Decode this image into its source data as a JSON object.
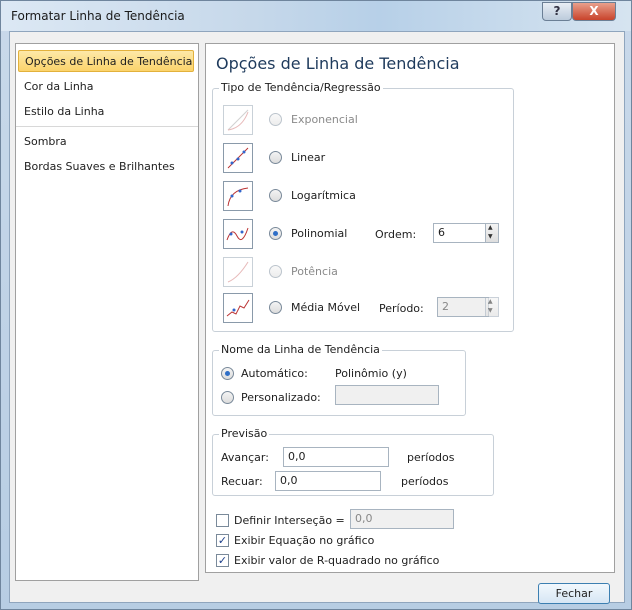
{
  "window": {
    "title": "Formatar Linha de Tendência",
    "help": "?",
    "close": "X"
  },
  "nav": {
    "items": [
      "Opções de Linha de Tendência",
      "Cor da Linha",
      "Estilo da Linha",
      "Sombra",
      "Bordas Suaves e Brilhantes"
    ],
    "selected": 0
  },
  "panel": {
    "title": "Opções de Linha de Tendência",
    "type_group": "Tipo de Tendência/Regressão",
    "types": {
      "exponencial": "Exponencial",
      "linear": "Linear",
      "logaritmica": "Logarítmica",
      "polinomial": "Polinomial",
      "potencia": "Potência",
      "media_movel": "Média Móvel"
    },
    "selected_type": "Polinomial",
    "ordem_label": "Ordem:",
    "ordem_value": "6",
    "periodo_label": "Período:",
    "periodo_value": "2",
    "name_group": "Nome da Linha de Tendência",
    "automatico_label": "Automático:",
    "automatico_value": "Polinômio (y)",
    "personalizado_label": "Personalizado:",
    "personalizado_value": "",
    "previsao_group": "Previsão",
    "avancar_label": "Avançar:",
    "avancar_value": "0,0",
    "recuar_label": "Recuar:",
    "recuar_value": "0,0",
    "periodos_1": "períodos",
    "periodos_2": "períodos",
    "interseccao_label": "Definir Interseção =",
    "interseccao_value": "0,0",
    "interseccao_checked": false,
    "equacao_label": "Exibir Equação no gráfico",
    "equacao_checked": true,
    "r2_label": "Exibir valor de R-quadrado no gráfico",
    "r2_checked": true
  },
  "footer": {
    "close_button": "Fechar"
  }
}
